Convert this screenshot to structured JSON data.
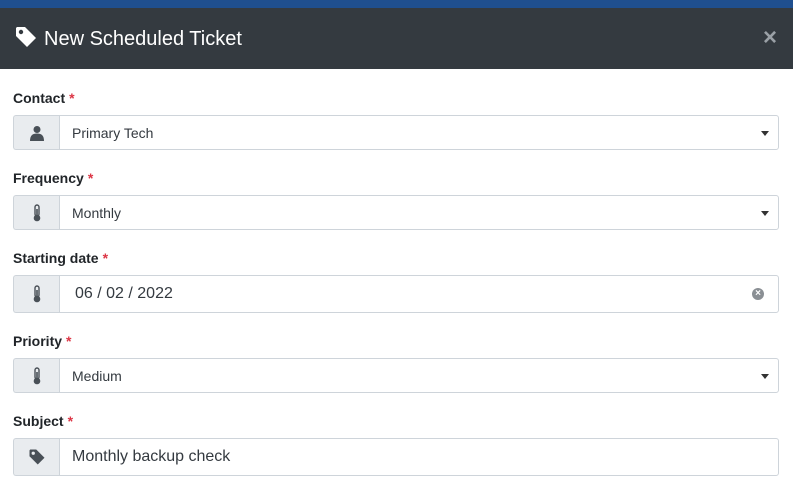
{
  "modal": {
    "title": "New Scheduled Ticket",
    "close_label": "×"
  },
  "form": {
    "required_mark": "*",
    "contact": {
      "label": "Contact",
      "value": "Primary Tech",
      "icon": "user-icon"
    },
    "frequency": {
      "label": "Frequency",
      "value": "Monthly",
      "icon": "thermometer-icon"
    },
    "starting_date": {
      "label": "Starting date",
      "value": "06 / 02 / 2022",
      "icon": "thermometer-icon"
    },
    "priority": {
      "label": "Priority",
      "value": "Medium",
      "icon": "thermometer-icon"
    },
    "subject": {
      "label": "Subject",
      "value": "Monthly backup check",
      "icon": "tag-icon"
    }
  },
  "colors": {
    "header_bg": "#343a40",
    "top_strip": "#1f4f8f",
    "required": "#dc3545",
    "addon_bg": "#e9ecef"
  }
}
